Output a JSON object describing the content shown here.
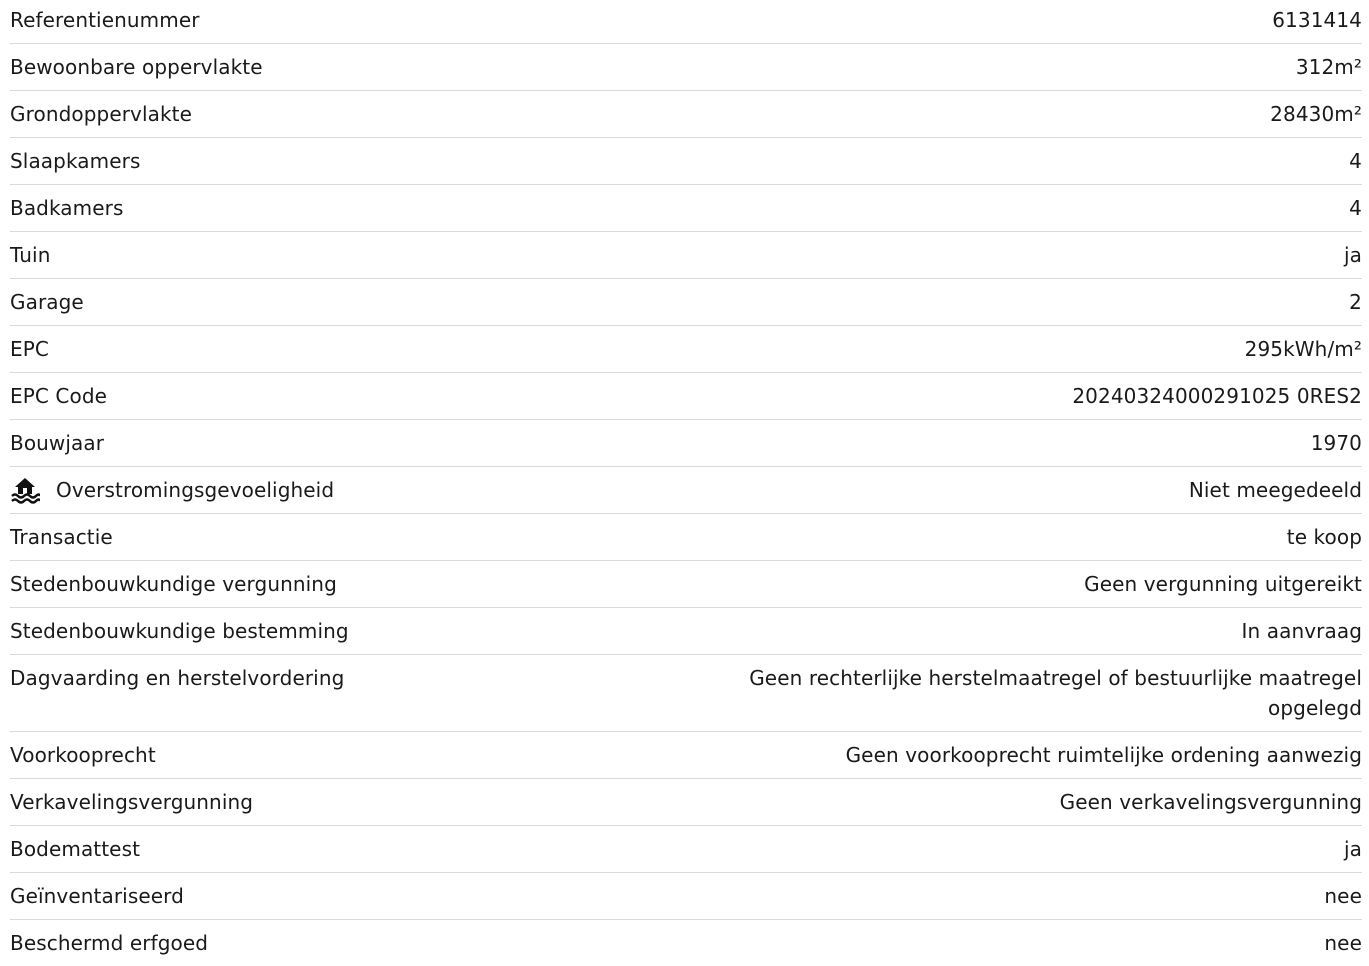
{
  "specs": {
    "rows": [
      {
        "label": "Referentienummer",
        "value": "6131414"
      },
      {
        "label": "Bewoonbare oppervlakte",
        "value": "312m²"
      },
      {
        "label": "Grondoppervlakte",
        "value": "28430m²"
      },
      {
        "label": "Slaapkamers",
        "value": "4"
      },
      {
        "label": "Badkamers",
        "value": "4"
      },
      {
        "label": "Tuin",
        "value": "ja"
      },
      {
        "label": "Garage",
        "value": "2"
      },
      {
        "label": "EPC",
        "value": "295kWh/m²"
      },
      {
        "label": "EPC Code",
        "value": "20240324000291025 0RES2"
      },
      {
        "label": "Bouwjaar",
        "value": "1970"
      },
      {
        "label": "Overstromingsgevoeligheid",
        "value": "Niet meegedeeld",
        "icon": "flood-house-icon"
      },
      {
        "label": "Transactie",
        "value": "te koop"
      },
      {
        "label": "Stedenbouwkundige vergunning",
        "value": "Geen vergunning uitgereikt"
      },
      {
        "label": "Stedenbouwkundige bestemming",
        "value": "In aanvraag"
      },
      {
        "label": "Dagvaarding en herstelvordering",
        "value": "Geen rechterlijke herstelmaatregel of bestuurlijke maatregel opgelegd"
      },
      {
        "label": "Voorkooprecht",
        "value": "Geen voorkooprecht ruimtelijke ordening aanwezig"
      },
      {
        "label": "Verkavelingsvergunning",
        "value": "Geen verkavelingsvergunning"
      },
      {
        "label": "Bodemattest",
        "value": "ja"
      },
      {
        "label": "Geïnventariseerd",
        "value": "nee"
      },
      {
        "label": "Beschermd erfgoed",
        "value": "nee"
      }
    ]
  }
}
